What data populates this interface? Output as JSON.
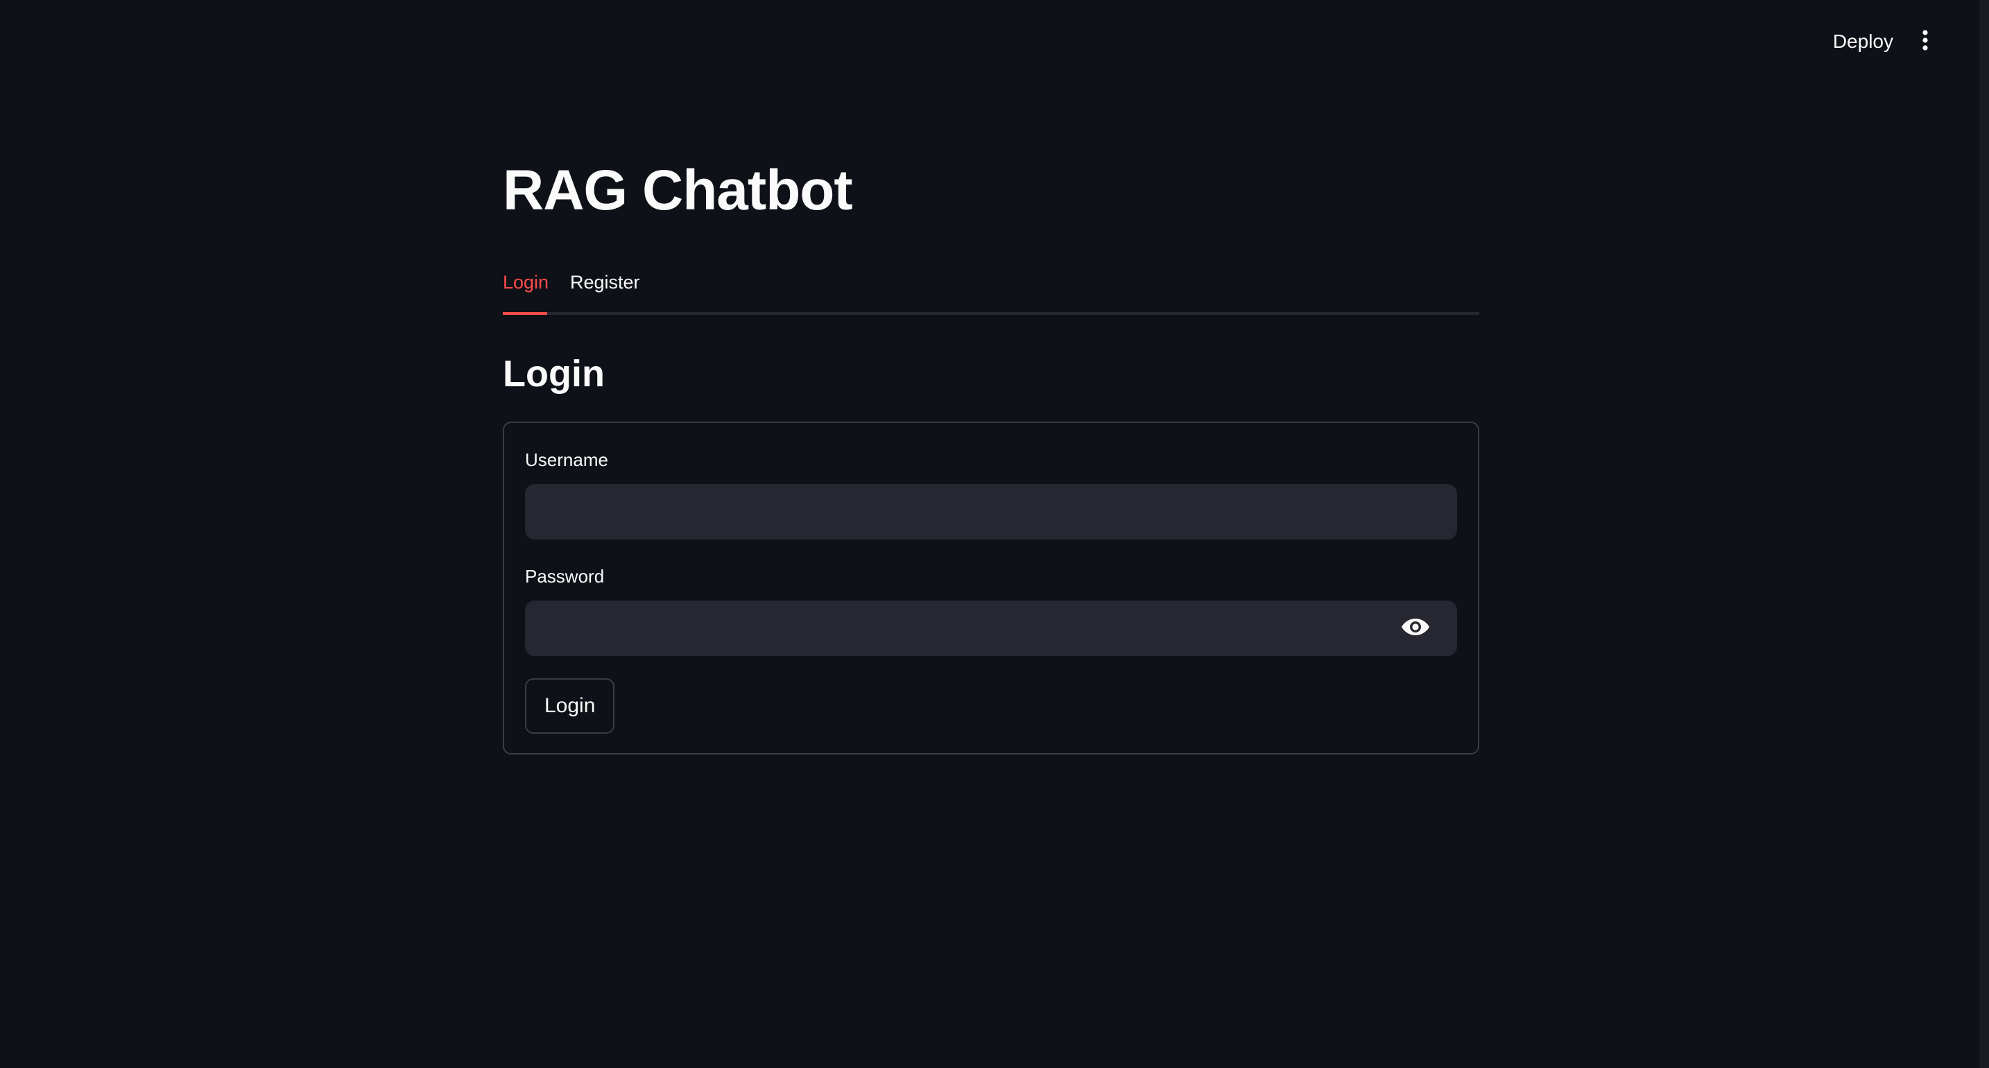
{
  "header": {
    "deploy_label": "Deploy",
    "menu_icon": "kebab-vertical-icon"
  },
  "page": {
    "title": "RAG Chatbot"
  },
  "tabs": [
    {
      "label": "Login",
      "active": true
    },
    {
      "label": "Register",
      "active": false
    }
  ],
  "login": {
    "heading": "Login",
    "username": {
      "label": "Username",
      "value": "",
      "placeholder": ""
    },
    "password": {
      "label": "Password",
      "value": "",
      "placeholder": "",
      "toggle_icon": "eye-icon"
    },
    "submit_label": "Login"
  },
  "colors": {
    "background": "#0e1117",
    "accent": "#ff4b4b",
    "input_background": "#262730",
    "text": "#fafafa"
  }
}
